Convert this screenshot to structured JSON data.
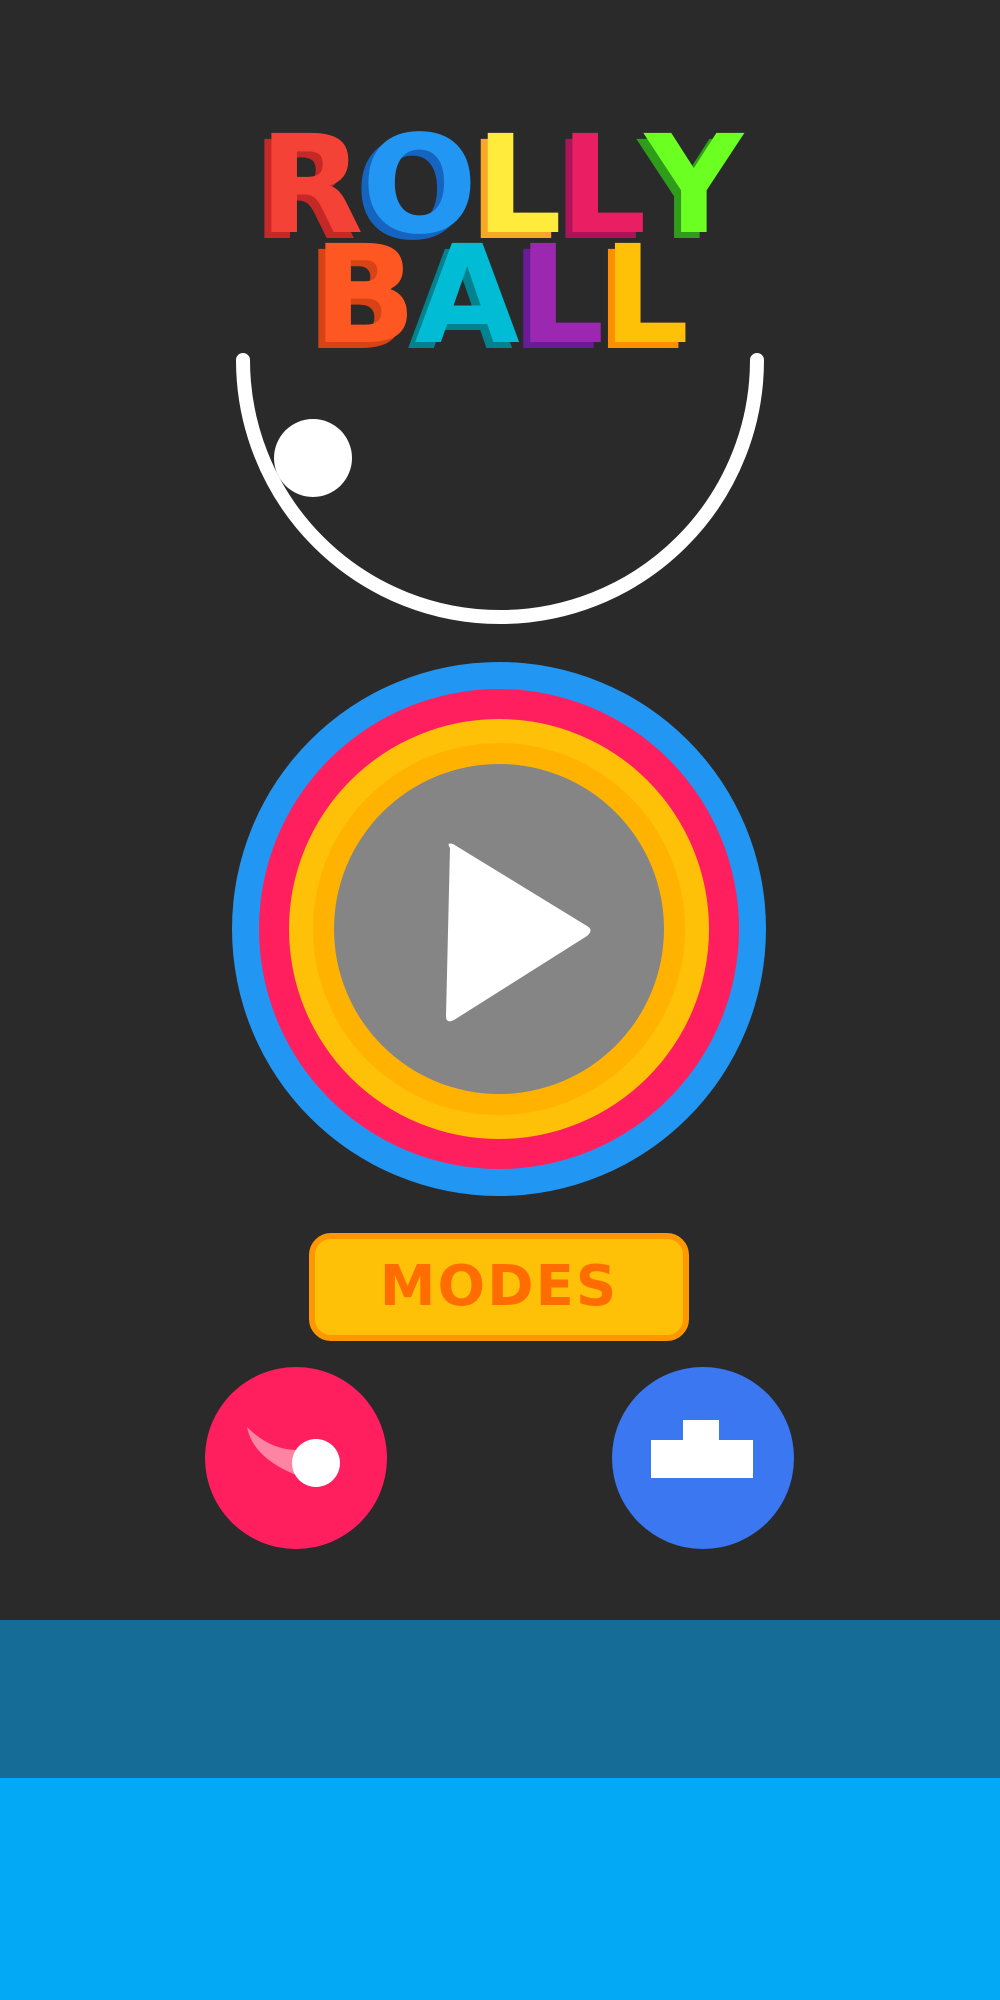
{
  "title": {
    "line1": [
      {
        "char": "R",
        "color": "#f44336",
        "shadow": "#c62828"
      },
      {
        "char": "O",
        "color": "#2196f3",
        "shadow": "#1565c0"
      },
      {
        "char": "L",
        "color": "#ffeb3b",
        "shadow": "#f9a825"
      },
      {
        "char": "L",
        "color": "#e91e63",
        "shadow": "#ad1457"
      },
      {
        "char": "Y",
        "color": "#6bff22",
        "shadow": "#2e9e1a"
      }
    ],
    "line2": [
      {
        "char": "B",
        "color": "#ff5722",
        "shadow": "#d84315"
      },
      {
        "char": "A",
        "color": "#00bcd4",
        "shadow": "#00838f"
      },
      {
        "char": "L",
        "color": "#9c27b0",
        "shadow": "#6a1b9a"
      },
      {
        "char": "L",
        "color": "#ffc107",
        "shadow": "#ff8f00"
      }
    ]
  },
  "icons": {
    "play": "play-icon",
    "skins": "ball-skin-icon",
    "leaderboard": "podium-icon"
  },
  "colors": {
    "background": "#2a2a2a",
    "ring_blue": "#2196f3",
    "ring_pink": "#ff1f5e",
    "ring_yellow": "#ffc107",
    "ring_amber": "#ffb300",
    "play_center": "#858585",
    "modes_fill": "#ffc107",
    "modes_text": "#ff6d00",
    "ad_banner_dark": "#156c96",
    "ad_banner_light": "#03a9f4"
  },
  "buttons": {
    "modes_label": "MODES"
  }
}
